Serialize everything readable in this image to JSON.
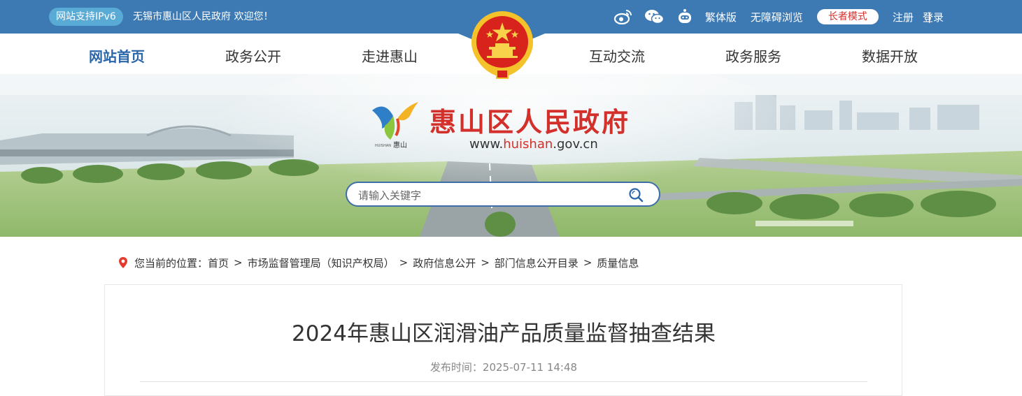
{
  "topbar": {
    "ipv6_badge": "网站支持IPv6",
    "welcome": "无锡市惠山区人民政府 欢迎您！",
    "icons": [
      "weibo-icon",
      "wechat-icon",
      "robot-icon"
    ],
    "traditional": "繁体版",
    "accessible": "无障碍浏览",
    "elder_mode": "长者模式",
    "register": "注册",
    "separator": "|",
    "login": "登录"
  },
  "nav": {
    "items": [
      "网站首页",
      "政务公开",
      "走进惠山",
      "互动交流",
      "政务服务",
      "数据开放"
    ],
    "active": "网站首页"
  },
  "banner": {
    "site_name": "惠山区人民政府",
    "url_prefix": "www.",
    "url_highlight": "huishan",
    "url_suffix": ".gov.cn",
    "logo_text": "惠山",
    "logo_small": "HUISHAN"
  },
  "search": {
    "placeholder": "请输入关键字"
  },
  "breadcrumb": {
    "prefix": "您当前的位置：",
    "items": [
      "首页",
      "市场监督管理局（知识产权局）",
      "政府信息公开",
      "部门信息公开目录",
      "质量信息"
    ]
  },
  "article": {
    "title": "2024年惠山区润滑油产品质量监督抽查结果",
    "publish_time": "发布时间：2025-07-11 14:48"
  },
  "colors": {
    "topbar": "#3d7ab3",
    "accent_red": "#d3302b",
    "nav_active": "#2a66a8"
  }
}
